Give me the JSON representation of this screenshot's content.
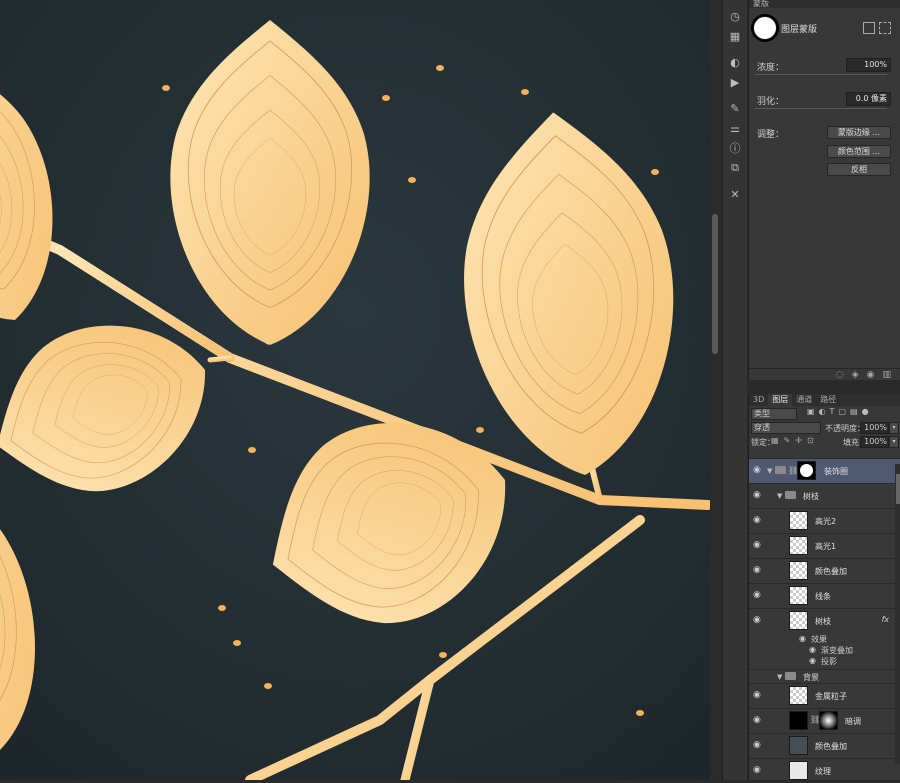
{
  "colors": {
    "canvas_bg": "#243036",
    "leaf_fill_light": "#fbe2b0",
    "leaf_fill_mid": "#f6c37a",
    "leaf_line": "#d99b55",
    "particle": "#f5b25a",
    "panel_bg": "#383838",
    "selected_layer": "#4e5870"
  },
  "toolstrip": {
    "icons": [
      "history-icon",
      "swatches-icon",
      "adjustments-icon",
      "actions-icon",
      "brush-icon",
      "properties-icon",
      "info-icon",
      "layer-comps-icon",
      "tools-icon"
    ]
  },
  "properties": {
    "header": "蒙版",
    "mask_name": "图层蒙版",
    "density_label": "浓度：",
    "density_value": "100%",
    "feather_label": "羽化：",
    "feather_value": "0.0 像素",
    "adjust_label": "调整：",
    "buttons": [
      "蒙版边缘 ...",
      "颜色范围 ...",
      "反相"
    ]
  },
  "layers_panel": {
    "tabs": [
      "3D",
      "图层",
      "通道",
      "路径"
    ],
    "filter_type": "类型",
    "blend_mode": "穿透",
    "opacity_label": "不透明度：",
    "opacity_value": "100%",
    "lock_label": "锁定：",
    "fill_label": "填充：",
    "fill_value": "100%",
    "layers": [
      {
        "name": "装饰圈",
        "kind": "group-mask",
        "selected": true
      },
      {
        "name": "树枝",
        "kind": "group"
      },
      {
        "name": "高光2",
        "kind": "layer"
      },
      {
        "name": "高光1",
        "kind": "layer"
      },
      {
        "name": "颜色叠加",
        "kind": "layer"
      },
      {
        "name": "线条",
        "kind": "layer"
      },
      {
        "name": "树枝",
        "kind": "layer-fx",
        "fx": "fx"
      },
      {
        "name": "效果",
        "kind": "effects"
      },
      {
        "name": "渐变叠加",
        "kind": "effect"
      },
      {
        "name": "投影",
        "kind": "effect"
      },
      {
        "name": "背景",
        "kind": "group"
      },
      {
        "name": "金属粒子",
        "kind": "layer"
      },
      {
        "name": "暗调",
        "kind": "adjustment"
      },
      {
        "name": "颜色叠加",
        "kind": "fill"
      },
      {
        "name": "纹理",
        "kind": "layer"
      }
    ]
  }
}
